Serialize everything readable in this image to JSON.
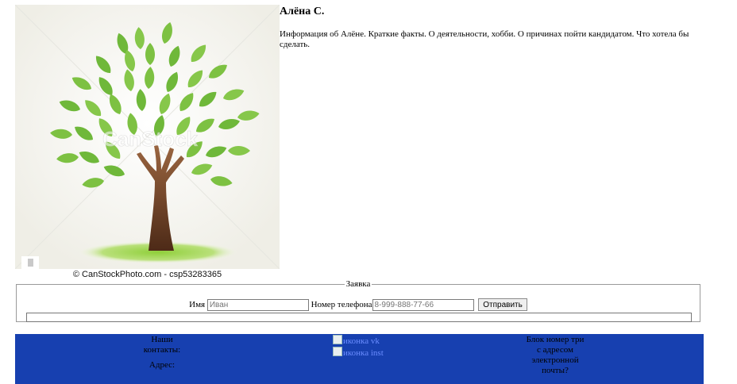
{
  "profile": {
    "name": "Алёна С.",
    "bio": "Информация об Алёне. Краткие факты. О деятельности, хобби. О причинах пойти кандидатом. Что хотела бы сделать."
  },
  "photo": {
    "watermark": "CanStock",
    "credit": "© CanStockPhoto.com - csp53283365"
  },
  "request_form": {
    "legend": "Заявка",
    "name_label": "Имя",
    "name_placeholder": "Иван",
    "phone_label": "Номер телефона",
    "phone_placeholder": "8-999-888-77-66",
    "submit_label": "Отправить"
  },
  "footer": {
    "contacts_title": "Наши контакты:",
    "address_label": "Адрес:",
    "vk_alt": "иконка vk",
    "inst_alt": "иконка inst",
    "email_block": "Блок номер три с адресом электронной почты?"
  },
  "colors": {
    "footer_bg": "#1740b0",
    "leaf_green": "#7dc142",
    "trunk_brown": "#6e3b1f"
  }
}
